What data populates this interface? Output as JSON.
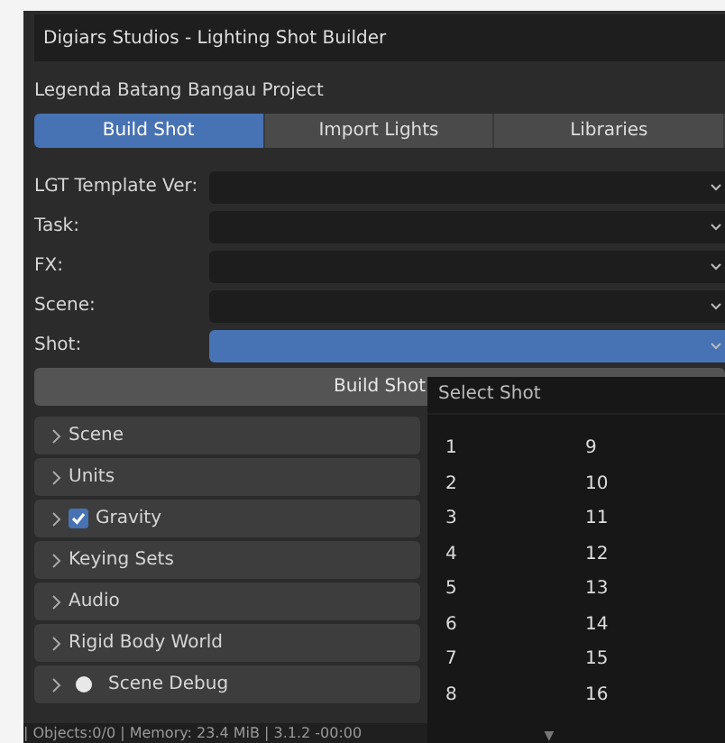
{
  "window": {
    "title": "Digiars Studios -  Lighting Shot Builder"
  },
  "project": "Legenda Batang Bangau Project",
  "tabs": [
    {
      "label": "Build Shot",
      "selected": true
    },
    {
      "label": "Import Lights",
      "selected": false
    },
    {
      "label": "Libraries",
      "selected": false
    }
  ],
  "fields": [
    {
      "label": "LGT Template Ver:",
      "active": false
    },
    {
      "label": "Task:",
      "active": false
    },
    {
      "label": "FX:",
      "active": false
    },
    {
      "label": "Scene:",
      "active": false
    },
    {
      "label": "Shot:",
      "active": true
    }
  ],
  "build_button": "Build Shot",
  "panels": [
    {
      "label": "Scene",
      "kind": "plain"
    },
    {
      "label": "Units",
      "kind": "plain"
    },
    {
      "label": "Gravity",
      "kind": "checkbox",
      "checked": true
    },
    {
      "label": "Keying Sets",
      "kind": "plain"
    },
    {
      "label": "Audio",
      "kind": "plain"
    },
    {
      "label": "Rigid Body World",
      "kind": "plain"
    },
    {
      "label": "Scene Debug",
      "kind": "dot"
    }
  ],
  "status_bar": "| Objects:0/0 | Memory: 23.4 MiB | 3.1.2 -00:00",
  "popup": {
    "title": "Select Shot",
    "columns": [
      [
        "1",
        "2",
        "3",
        "4",
        "5",
        "6",
        "7",
        "8"
      ],
      [
        "9",
        "10",
        "11",
        "12",
        "13",
        "14",
        "15",
        "16"
      ]
    ],
    "more": "▼"
  }
}
